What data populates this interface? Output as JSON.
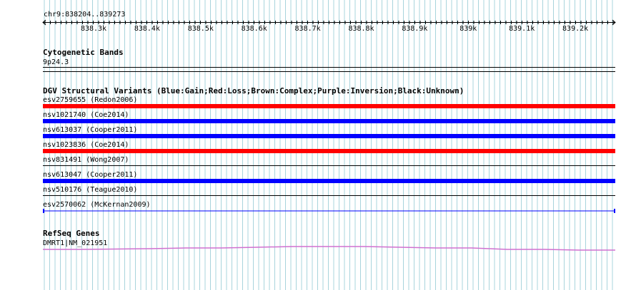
{
  "ruler": {
    "location": "chr9:838204..839273",
    "ticks": [
      "838.3k",
      "838.4k",
      "838.5k",
      "838.6k",
      "838.7k",
      "838.8k",
      "838.9k",
      "839k",
      "839.1k",
      "839.2k"
    ]
  },
  "cytoband": {
    "title": "Cytogenetic Bands",
    "band": "9p24.3"
  },
  "dgv": {
    "title": "DGV Structural Variants (Blue:Gain;Red:Loss;Brown:Complex;Purple:Inversion;Black:Unknown)",
    "variants": [
      {
        "label": "esv2759655 (Redon2006)",
        "type": "loss",
        "color": "#ff0000"
      },
      {
        "label": "nsv1021740 (Coe2014)",
        "type": "gain",
        "color": "#0000ff"
      },
      {
        "label": "nsv613037 (Cooper2011)",
        "type": "gain",
        "color": "#0000ff"
      },
      {
        "label": "nsv1023836 (Coe2014)",
        "type": "loss",
        "color": "#ff0000"
      },
      {
        "label": "nsv831491 (Wong2007)",
        "type": "unknown",
        "color": "#000000"
      },
      {
        "label": "nsv613047 (Cooper2011)",
        "type": "gain",
        "color": "#0000ff"
      },
      {
        "label": "nsv510176 (Teague2010)",
        "type": "unknown",
        "color": "#000000"
      },
      {
        "label": "esv2570062 (McKernan2009)",
        "type": "gain-thin",
        "color": "#0000ff"
      }
    ]
  },
  "refseq": {
    "title": "RefSeq Genes",
    "gene": "DMRT1|NM_021951",
    "color": "#d070d0"
  },
  "colors": {
    "grid": "#a8d4dc",
    "ruler": "#000000"
  }
}
